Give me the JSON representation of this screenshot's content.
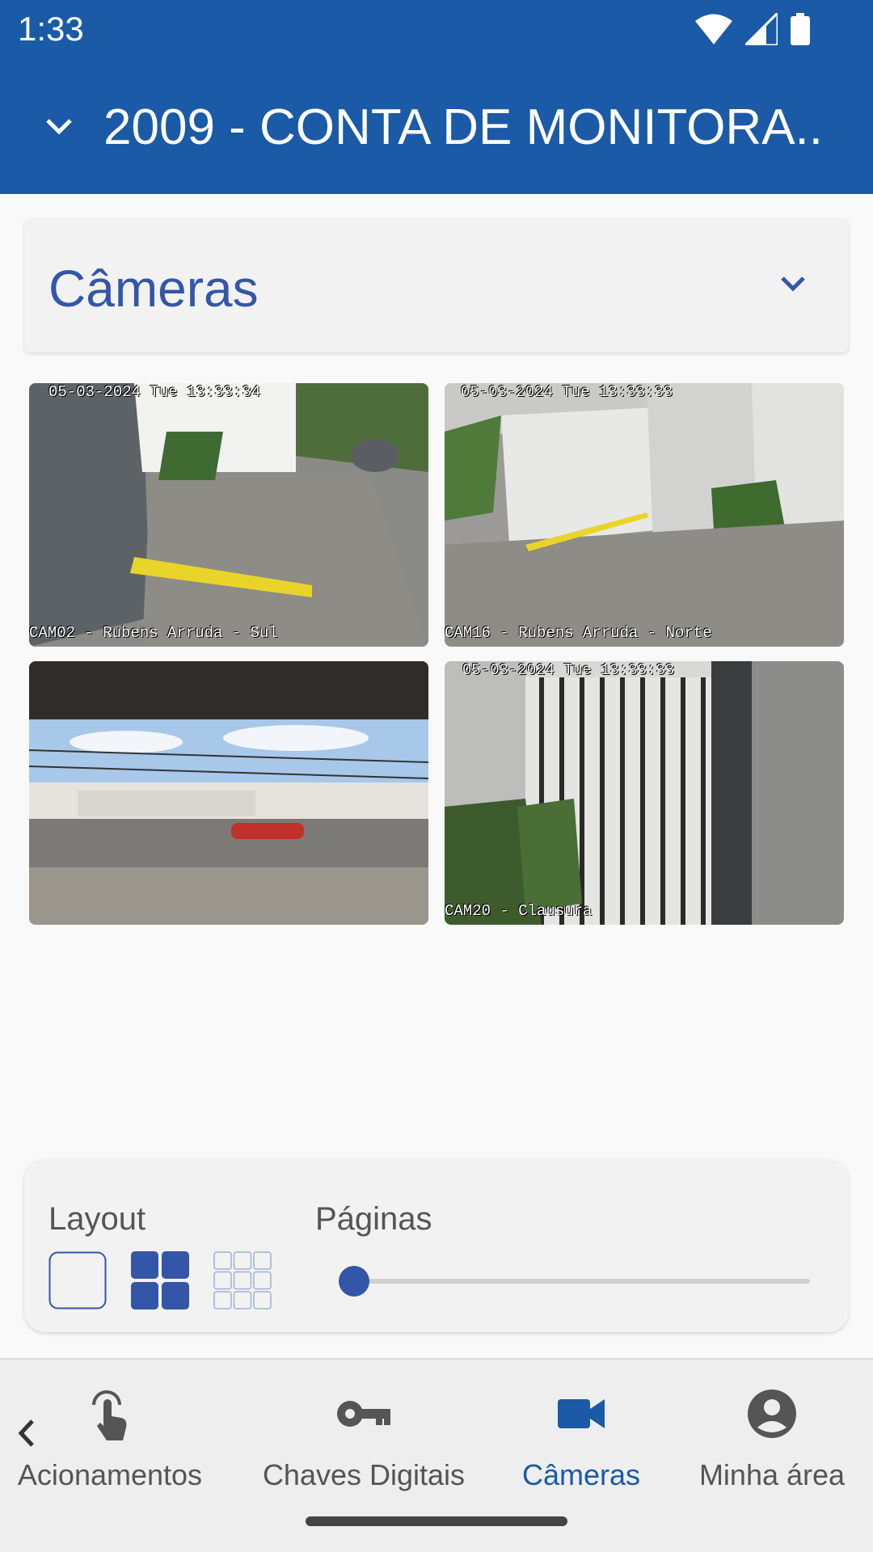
{
  "status_bar": {
    "time": "1:33"
  },
  "app_bar": {
    "title": "2009 - CONTA DE MONITORA..",
    "collapse_icon": "chevron-down-icon"
  },
  "cameras_section": {
    "title": "Câmeras",
    "expand_icon": "chevron-down-icon"
  },
  "camera_tiles": [
    {
      "timestamp": "05-03-2024 Tue 13:33:34",
      "name": "CAM02 - Rubens Arruda - Sul"
    },
    {
      "timestamp": "05-03-2024 Tue 13:33:33",
      "name": "CAM16 - Rubens Arruda - Norte"
    },
    {
      "timestamp": "",
      "name": ""
    },
    {
      "timestamp": "05-03-2024 Tue 13:33:33",
      "name": "CAM20 - Clausura"
    }
  ],
  "controls": {
    "layout_label": "Layout",
    "pages_label": "Páginas",
    "layout_options": [
      "single",
      "grid-2x2",
      "grid-3x3"
    ],
    "selected_layout": "grid-2x2",
    "page_slider_value": 0,
    "accent_color": "#3356a8"
  },
  "bottom_nav": {
    "items": [
      {
        "label": "Acionamentos",
        "icon": "touch-icon"
      },
      {
        "label": "Chaves Digitais",
        "icon": "key-icon"
      },
      {
        "label": "Câmeras",
        "icon": "videocam-icon",
        "active": true
      },
      {
        "label": "Minha área",
        "icon": "account-circle-icon"
      }
    ],
    "active_color": "#1b5aa6"
  }
}
